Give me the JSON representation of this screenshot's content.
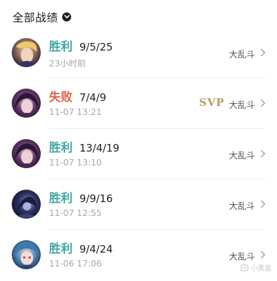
{
  "header": {
    "title": "全部战绩"
  },
  "matches": [
    {
      "result": "胜利",
      "result_type": "win",
      "kda": "9/5/25",
      "time": "23小时前",
      "mode": "大乱斗",
      "badge": ""
    },
    {
      "result": "失败",
      "result_type": "lose",
      "kda": "7/4/9",
      "time": "11-07 13:21",
      "mode": "大乱斗",
      "badge": "SVP"
    },
    {
      "result": "胜利",
      "result_type": "win",
      "kda": "13/4/19",
      "time": "11-07 13:10",
      "mode": "大乱斗",
      "badge": ""
    },
    {
      "result": "胜利",
      "result_type": "win",
      "kda": "9/9/16",
      "time": "11-07 12:55",
      "mode": "大乱斗",
      "badge": ""
    },
    {
      "result": "胜利",
      "result_type": "win",
      "kda": "9/4/24",
      "time": "11-06 17:06",
      "mode": "大乱斗",
      "badge": ""
    }
  ],
  "colors": {
    "win": "#3fa8a3",
    "lose": "#e0664d",
    "svp": "#b99a63"
  },
  "watermark": "小黑盒"
}
